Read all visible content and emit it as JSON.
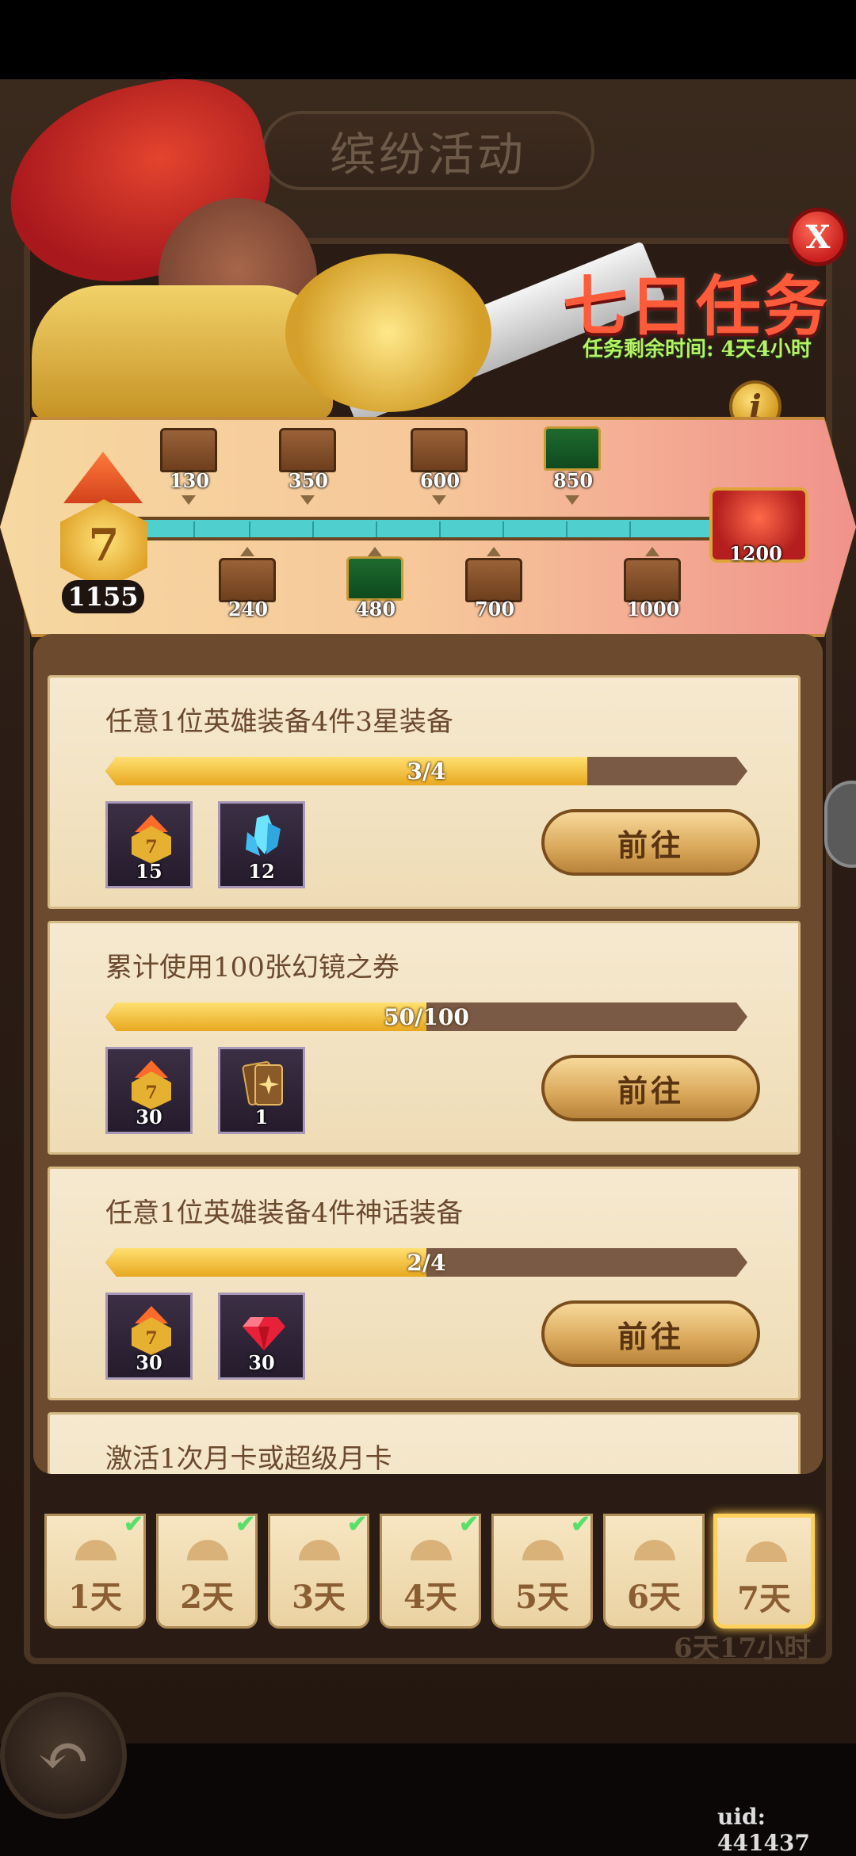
{
  "screen": {
    "window_title": "缤纷活动",
    "event_title": "七日任务",
    "event_timer": "任务剩余时间: 4天4小时",
    "close_label": "X",
    "info_label": "i"
  },
  "progress": {
    "level_label": "7",
    "score": "1155",
    "milestones_top": [
      "130",
      "350",
      "600",
      "850"
    ],
    "milestones_bottom": [
      "240",
      "480",
      "700",
      "1000"
    ],
    "final_milestone": "1200"
  },
  "tasks": [
    {
      "title": "任意1位英雄装备4件3星装备",
      "progress_text": "3/4",
      "progress_fraction": 0.75,
      "rewards": [
        {
          "icon": "score-medal-icon",
          "qty": "15"
        },
        {
          "icon": "blue-crystal-icon",
          "qty": "12"
        }
      ],
      "button": "前往"
    },
    {
      "title": "累计使用100张幻镜之券",
      "progress_text": "50/100",
      "progress_fraction": 0.5,
      "rewards": [
        {
          "icon": "score-medal-icon",
          "qty": "30"
        },
        {
          "icon": "mirror-card-icon",
          "qty": "1"
        }
      ],
      "button": "前往"
    },
    {
      "title": "任意1位英雄装备4件神话装备",
      "progress_text": "2/4",
      "progress_fraction": 0.5,
      "rewards": [
        {
          "icon": "score-medal-icon",
          "qty": "30"
        },
        {
          "icon": "ruby-gem-icon",
          "qty": "30"
        }
      ],
      "button": "前往"
    },
    {
      "title": "激活1次月卡或超级月卡"
    }
  ],
  "days": [
    {
      "label": "1天",
      "completed": true
    },
    {
      "label": "2天",
      "completed": true
    },
    {
      "label": "3天",
      "completed": true
    },
    {
      "label": "4天",
      "completed": true
    },
    {
      "label": "5天",
      "completed": true
    },
    {
      "label": "6天",
      "completed": false
    },
    {
      "label": "7天",
      "completed": false,
      "active": true
    }
  ],
  "day_timer": "6天17小时",
  "uid": "uid: 441437",
  "colors": {
    "accent_gold": "#e8a820",
    "title_red": "#ff5a3a",
    "timer_green": "#b4f266",
    "track_teal": "#4fd0cf"
  }
}
